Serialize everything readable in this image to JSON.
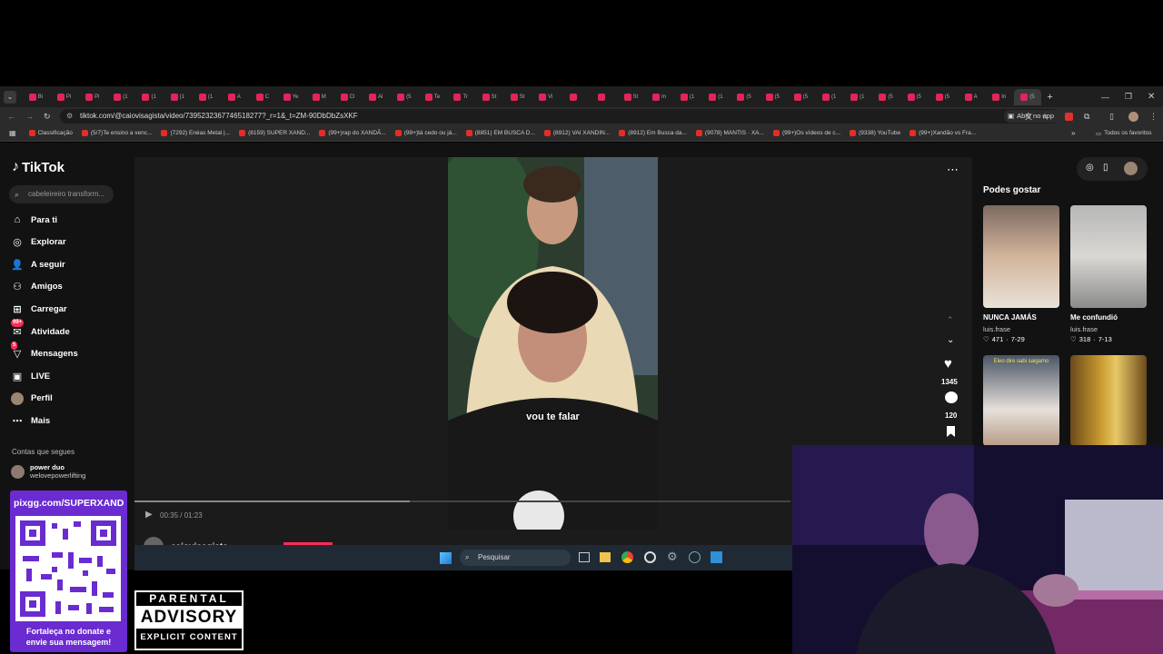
{
  "browser": {
    "tabs": [
      "Bi",
      "Pi",
      "Pi",
      "(1",
      "(1",
      "(1",
      "(1",
      "A",
      "C",
      "Ye",
      "M",
      "Cl",
      "Al",
      "(5",
      "Te",
      "Tr",
      "St",
      "St",
      "Vi",
      "",
      "",
      "St",
      "In",
      "(1",
      "(1",
      "(5",
      "(5",
      "(5",
      "(1",
      "(1",
      "(5",
      "(5",
      "(5",
      "A",
      "In",
      "(5"
    ],
    "url": "tiktok.com/@caiovisagista/video/7395232367746518277?_r=1&_t=ZM-90DbDbZsXKF",
    "open_in_app": "Abrir no app",
    "bookmarks": [
      "Classificação",
      "(5/7)Te ensino a venc...",
      "(7292) Enéas Metal |...",
      "(8159) SUPER XAND...",
      "(99+)rap do XANDÃ...",
      "(99+)tá cedo ou já...",
      "(8851) EM BUSCA D...",
      "(8912) VAI XANDIN...",
      "(8912) Em Busca da...",
      "(9078) MANTIS · XA...",
      "(99+)Os vídeos de c...",
      "(9338) YouTube",
      "(99+)Xandão vs Fra..."
    ],
    "all_bookmarks": "Todos os favoritos"
  },
  "tiktok": {
    "logo": "TikTok",
    "search_placeholder": "cabeleireiro transform...",
    "nav": [
      {
        "label": "Para ti",
        "icon": "home-icon"
      },
      {
        "label": "Explorar",
        "icon": "compass-icon"
      },
      {
        "label": "A seguir",
        "icon": "following-icon"
      },
      {
        "label": "Amigos",
        "icon": "friends-icon"
      },
      {
        "label": "Carregar",
        "icon": "upload-icon"
      },
      {
        "label": "Atividade",
        "icon": "activity-icon",
        "badge": "99+"
      },
      {
        "label": "Mensagens",
        "icon": "messages-icon",
        "badge": "5"
      },
      {
        "label": "LIVE",
        "icon": "live-icon"
      },
      {
        "label": "Perfil",
        "icon": "profile-icon"
      },
      {
        "label": "Mais",
        "icon": "more-icon"
      }
    ],
    "following_title": "Contas que segues",
    "following_account": "power duo",
    "following_handle": "welovepowerlifting",
    "video": {
      "caption": "vou te falar",
      "time": "00:35 / 01:23",
      "author": "caiovisagista",
      "likes": "1345",
      "comments": "120"
    },
    "recommend_title": "Podes gostar",
    "recommendations": [
      {
        "title": "NUNCA JAMÁS",
        "author": "luis.frase",
        "likes": "471",
        "date": "7-29"
      },
      {
        "title": "Me confundió",
        "author": "luis.frase",
        "likes": "318",
        "date": "7-13"
      }
    ],
    "thumb3_overlay": "Eleo dire  sabi saigamo"
  },
  "taskbar": {
    "search_placeholder": "Pesquisar"
  },
  "overlay": {
    "qr_url": "pixgg.com/SUPERXAND",
    "qr_caption": "Fortaleça no donate e envie sua mensagem!",
    "pa_line1": "PARENTAL",
    "pa_line2": "ADVISORY",
    "pa_line3": "EXPLICIT CONTENT"
  },
  "colors": {
    "tiktok_red": "#fe2c55",
    "page_bg": "#121212",
    "qr_purple": "#6a2bd0"
  }
}
